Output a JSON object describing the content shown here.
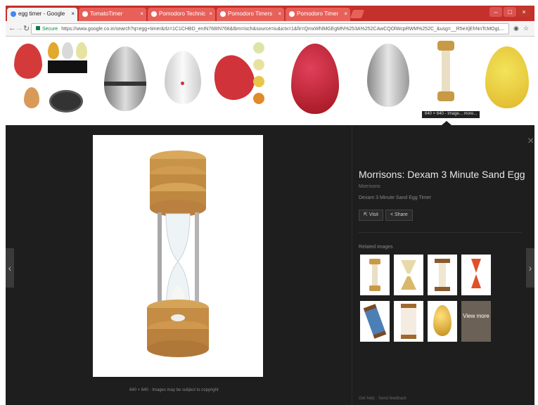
{
  "tabs": [
    {
      "label": "egg timer - Google",
      "active": true
    },
    {
      "label": "TomatoTimer",
      "active": false
    },
    {
      "label": "Pomodoro Technic",
      "active": false
    },
    {
      "label": "Pomodoro Timers",
      "active": false
    },
    {
      "label": "Pomodoro Timer",
      "active": false
    }
  ],
  "address": {
    "secure_label": "Secure",
    "url": "https://www.google.co.in/search?q=egg+timer&rlz=1C1CHBD_enIN768IN768&tbm=isch&source=iu&ictx=1&fir=QmxWhlMGEgMN%253A%252CAwCQOlWcpRWM%252C_&usg=__R5eXjEhNnTcMOgL..."
  },
  "thumbnail_tooltip": "640 × 640 - Image... more...",
  "viewer": {
    "caption": "640 × 640 · Images may be subject to copyright",
    "title": "Morrisons: Dexam 3 Minute Sand Egg Tim...",
    "site": "Morrisons",
    "description": "Dexam 3 Minute Sand Egg Timer",
    "visit_label": "Visit",
    "share_label": "Share",
    "related_label": "Related images",
    "view_more_label": "View more",
    "footer": "Get help · Send feedback"
  },
  "colors": {
    "tab_bar": "#c4302b",
    "viewer_bg": "#1e1e1e",
    "secure_green": "#0b8043"
  }
}
